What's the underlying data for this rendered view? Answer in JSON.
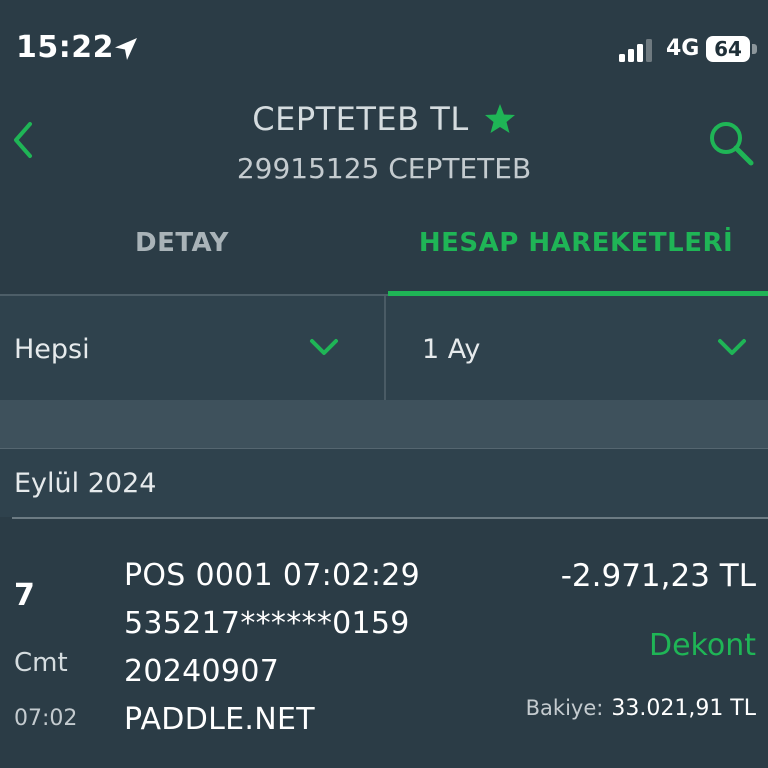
{
  "status_bar": {
    "time": "15:22",
    "network": "4G",
    "battery": "64",
    "location_icon": "location-arrow-icon",
    "signal_icon": "cellular-signal-icon"
  },
  "header": {
    "title": "CEPTETEB TL",
    "subtitle": "29915125 CEPTETEB",
    "back_icon": "chevron-left-icon",
    "search_icon": "search-icon",
    "favorite_icon": "star-icon"
  },
  "tabs": [
    {
      "label": "DETAY",
      "active": false
    },
    {
      "label": "HESAP HAREKETLERİ",
      "active": true
    }
  ],
  "filters": {
    "type": "Hepsi",
    "period": "1 Ay"
  },
  "month": "Eylül 2024",
  "transactions": [
    {
      "day": "7",
      "weekday": "Cmt",
      "time": "07:02",
      "description_lines": [
        "POS 0001 07:02:29",
        "535217******0159",
        "20240907",
        "PADDLE.NET"
      ],
      "amount": "-2.971,23 TL",
      "receipt_label": "Dekont",
      "balance_label": "Bakiye:",
      "balance": "33.021,91 TL"
    }
  ],
  "colors": {
    "background": "#2b3c46",
    "panel": "#2f424d",
    "band": "#3e515c",
    "accent_green": "#1fb556",
    "text": "#ffffff"
  }
}
